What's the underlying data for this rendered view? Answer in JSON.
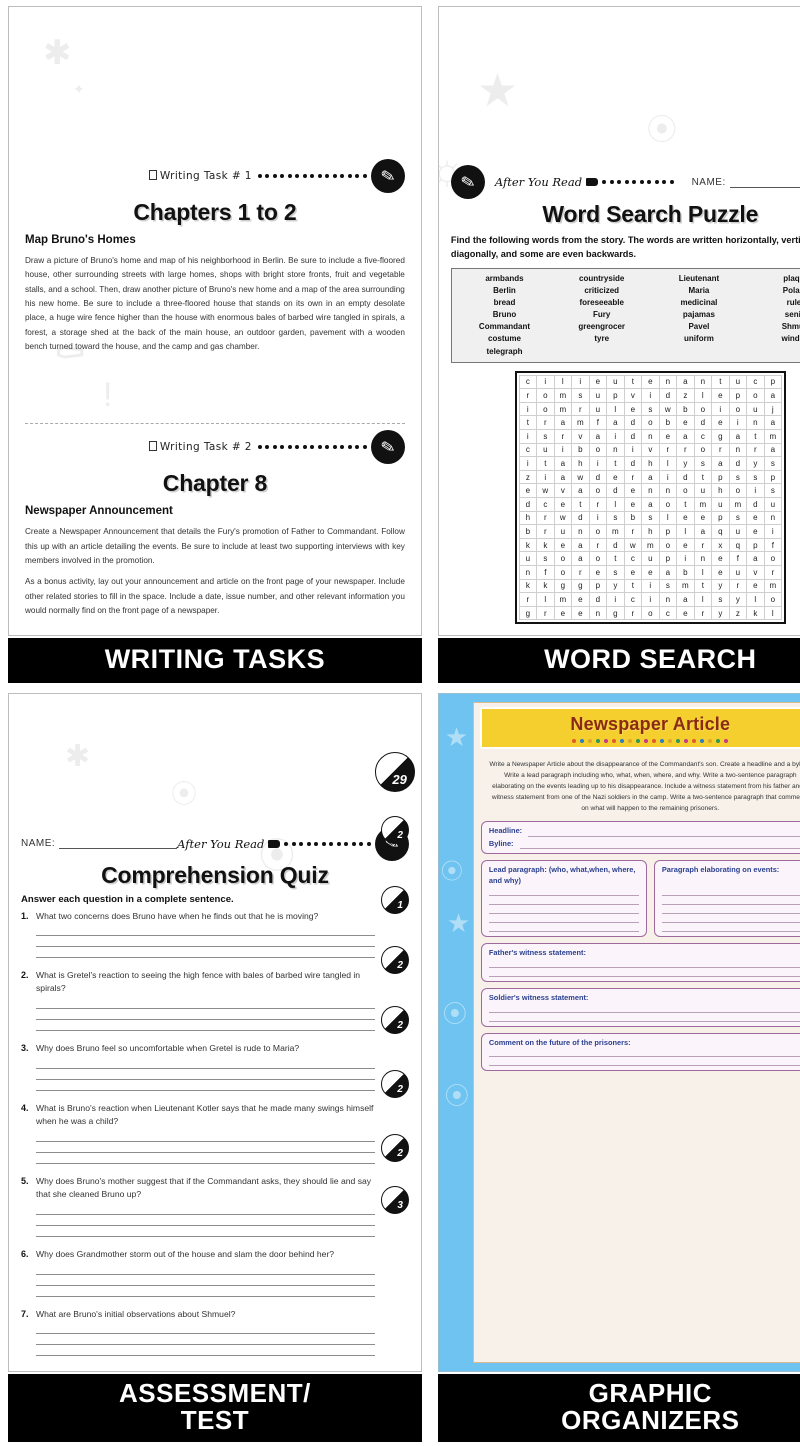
{
  "quadrants": {
    "writing_tasks": {
      "caption": "WRITING TASKS",
      "task1": {
        "tag": "Writing Task # 1",
        "title": "Chapters 1 to 2",
        "subtitle": "Map Bruno's Homes",
        "paragraph": "Draw a picture of Bruno's home and map of his neighborhood in Berlin. Be sure to include a five-floored house, other surrounding streets with large homes, shops with bright store fronts, fruit and vegetable stalls, and a school. Then, draw another picture of Bruno's new home and a map of the area surrounding his new home. Be sure to include a three-floored house that stands on its own in an empty desolate place, a huge wire fence higher than the house with enormous bales of barbed wire tangled in spirals, a forest, a storage shed at the back of the main house, an outdoor garden, pavement with a wooden bench turned toward the house, and the camp and gas chamber."
      },
      "task2": {
        "tag": "Writing Task # 2",
        "title": "Chapter 8",
        "subtitle": "Newspaper Announcement",
        "paragraph1": "Create a Newspaper Announcement that details the Fury's promotion of Father to Commandant. Follow this up with an article detailing the events. Be sure to include at least two supporting interviews with key members involved in the promotion.",
        "paragraph2": "As a bonus activity, lay out your announcement and article on the front page of your newspaper. Include other related stories to fill in the space. Include a date, issue number, and other relevant information you would normally find on the front page of a newspaper."
      }
    },
    "word_search": {
      "caption": "WORD SEARCH",
      "after_tag": "After You Read",
      "name_label": "NAME:",
      "title": "Word Search Puzzle",
      "instructions": "Find the following words from the story. The words are written horizontally, vertically, diagonally, and some are even backwards.",
      "word_bank": [
        [
          "armbands",
          "Berlin",
          "bread",
          "Bruno",
          "Commandant",
          "costume",
          "telegraph"
        ],
        [
          "countryside",
          "criticized",
          "foreseeable",
          "Fury",
          "greengrocer",
          "tyre"
        ],
        [
          "Lieutenant",
          "Maria",
          "medicinal",
          "pajamas",
          "Pavel",
          "uniform"
        ],
        [
          "plaque",
          "Poland",
          "rules",
          "senile",
          "Shmuel",
          "window"
        ]
      ],
      "grid": [
        [
          "c",
          "i",
          "l",
          "i",
          "e",
          "u",
          "t",
          "e",
          "n",
          "a",
          "n",
          "t",
          "u",
          "c",
          "p"
        ],
        [
          "r",
          "o",
          "m",
          "s",
          "u",
          "p",
          "v",
          "i",
          "d",
          "z",
          "l",
          "e",
          "p",
          "o",
          "a"
        ],
        [
          "i",
          "o",
          "m",
          "r",
          "u",
          "l",
          "e",
          "s",
          "w",
          "b",
          "o",
          "i",
          "o",
          "u",
          "j"
        ],
        [
          "t",
          "r",
          "a",
          "m",
          "f",
          "a",
          "d",
          "o",
          "b",
          "e",
          "d",
          "e",
          "i",
          "n",
          "a"
        ],
        [
          "i",
          "s",
          "r",
          "v",
          "a",
          "i",
          "d",
          "n",
          "e",
          "a",
          "c",
          "g",
          "a",
          "t",
          "m"
        ],
        [
          "c",
          "u",
          "i",
          "b",
          "o",
          "n",
          "i",
          "v",
          "r",
          "r",
          "o",
          "r",
          "n",
          "r",
          "a"
        ],
        [
          "i",
          "t",
          "a",
          "h",
          "i",
          "t",
          "d",
          "h",
          "l",
          "y",
          "s",
          "a",
          "d",
          "y",
          "s"
        ],
        [
          "z",
          "i",
          "a",
          "w",
          "d",
          "e",
          "r",
          "a",
          "i",
          "d",
          "t",
          "p",
          "s",
          "s",
          "p"
        ],
        [
          "e",
          "w",
          "v",
          "a",
          "o",
          "d",
          "e",
          "n",
          "n",
          "o",
          "u",
          "h",
          "o",
          "i",
          "s"
        ],
        [
          "d",
          "c",
          "e",
          "t",
          "r",
          "l",
          "e",
          "a",
          "o",
          "t",
          "m",
          "u",
          "m",
          "d",
          "u"
        ],
        [
          "h",
          "r",
          "w",
          "d",
          "i",
          "s",
          "b",
          "s",
          "l",
          "e",
          "e",
          "p",
          "s",
          "e",
          "n"
        ],
        [
          "b",
          "r",
          "u",
          "n",
          "o",
          "m",
          "r",
          "h",
          "p",
          "l",
          "a",
          "q",
          "u",
          "e",
          "i"
        ],
        [
          "k",
          "k",
          "e",
          "a",
          "r",
          "d",
          "w",
          "m",
          "o",
          "e",
          "r",
          "x",
          "q",
          "p",
          "f"
        ],
        [
          "u",
          "s",
          "o",
          "a",
          "o",
          "t",
          "c",
          "u",
          "p",
          "i",
          "n",
          "e",
          "f",
          "a",
          "o"
        ],
        [
          "n",
          "f",
          "o",
          "r",
          "e",
          "s",
          "e",
          "e",
          "a",
          "b",
          "l",
          "e",
          "u",
          "v",
          "r"
        ],
        [
          "k",
          "k",
          "g",
          "g",
          "p",
          "y",
          "t",
          "i",
          "s",
          "m",
          "t",
          "y",
          "r",
          "e",
          "m"
        ],
        [
          "r",
          "l",
          "m",
          "e",
          "d",
          "i",
          "c",
          "i",
          "n",
          "a",
          "l",
          "s",
          "y",
          "l",
          "o"
        ],
        [
          "g",
          "r",
          "e",
          "e",
          "n",
          "g",
          "r",
          "o",
          "c",
          "e",
          "r",
          "y",
          "z",
          "k",
          "l"
        ]
      ]
    },
    "assessment": {
      "caption_line1": "ASSESSMENT/",
      "caption_line2": "TEST",
      "name_label": "NAME:",
      "after_tag": "After You Read",
      "title": "Comprehension Quiz",
      "instructions": "Answer each question in a complete sentence.",
      "total_score": "29",
      "questions": [
        {
          "num": "1.",
          "text": "What two concerns does Bruno have when he finds out that he is moving?",
          "lines": 3,
          "points": "2"
        },
        {
          "num": "2.",
          "text": "What is Gretel's reaction to seeing the high fence with bales of barbed wire tangled in spirals?",
          "lines": 3,
          "points": "1"
        },
        {
          "num": "3.",
          "text": "Why does Bruno feel so uncomfortable when Gretel is rude to Maria?",
          "lines": 3,
          "points": "2"
        },
        {
          "num": "4.",
          "text": "What is Bruno's reaction when Lieutenant Kotler says that he made many swings himself when he was a child?",
          "lines": 3,
          "points": "2"
        },
        {
          "num": "5.",
          "text": "Why does Bruno's mother suggest that if the Commandant asks, they should lie and say that she cleaned Bruno up?",
          "lines": 3,
          "points": "2"
        },
        {
          "num": "6.",
          "text": "Why does Grandmother storm out of the house and slam the door behind her?",
          "lines": 3,
          "points": "2"
        },
        {
          "num": "7.",
          "text": "What are Bruno's initial observations about Shmuel?",
          "lines": 3,
          "points": "3"
        }
      ]
    },
    "graphic_organizers": {
      "caption_line1": "GRAPHIC",
      "caption_line2": "ORGANIZERS",
      "title": "Newspaper Article",
      "intro": "Write a Newspaper Article about the disappearance of the Commandant's son. Create a headline and a byline. Write a lead paragraph including who, what, when, where, and why. Write a two-sentence paragraph elaborating on the events leading up to his disappearance. Include a witness statement from his father and a witness statement from one of the Nazi soldiers in the camp. Write a two-sentence paragraph that comments on what will happen to the remaining prisoners.",
      "fields": {
        "headline": "Headline:",
        "byline": "Byline:",
        "lead": "Lead paragraph: (who, what,when, where, and why)",
        "elaborate": "Paragraph elaborating on events:",
        "father": "Father's witness statement:",
        "soldier": "Soldier's witness statement:",
        "future": "Comment on the future of the prisoners:"
      },
      "colors": {
        "background": "#6ec3f0",
        "header": "#f5cf2e",
        "title_text": "#8a2a12",
        "box_border": "#9e6a9e",
        "label_text": "#2a3f8f",
        "paper": "#f7f1ea"
      }
    }
  }
}
